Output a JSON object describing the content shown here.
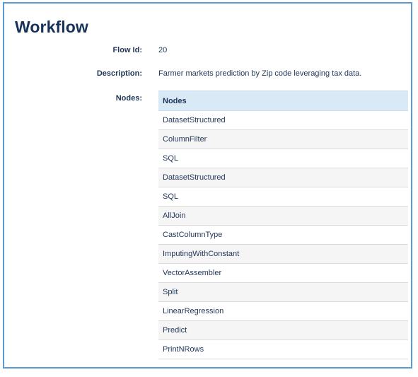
{
  "workflow": {
    "title": "Workflow",
    "flow_id_label": "Flow Id:",
    "flow_id_value": "20",
    "description_label": "Description:",
    "description_value": "Farmer markets prediction by Zip code leveraging tax data.",
    "nodes_label": "Nodes:",
    "nodes_header": "Nodes",
    "nodes": [
      "DatasetStructured",
      "ColumnFilter",
      "SQL",
      "DatasetStructured",
      "SQL",
      "AllJoin",
      "CastColumnType",
      "ImputingWithConstant",
      "VectorAssembler",
      "Split",
      "LinearRegression",
      "Predict",
      "PrintNRows"
    ]
  },
  "colors": {
    "frame_border": "#5b9bd5",
    "header_bg": "#d9e9f6",
    "title_text": "#17325a",
    "body_text": "#1f3557",
    "row_alt_bg": "#f5f5f5"
  }
}
